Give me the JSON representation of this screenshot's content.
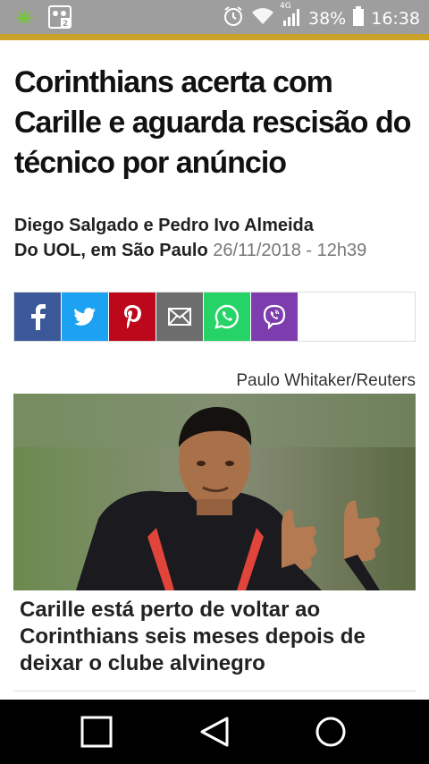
{
  "status_bar": {
    "battery_percent": "38%",
    "time": "16:38",
    "network_label": "4G",
    "icons": [
      "cannabis-leaf-icon",
      "notification-icon",
      "alarm-icon",
      "wifi-icon",
      "signal-icon",
      "battery-icon"
    ]
  },
  "article": {
    "headline": "Corinthians acerta com Carille e aguarda rescisão do técnico por anúncio",
    "authors": "Diego Salgado e Pedro Ivo Almeida",
    "org": "Do UOL, em São Paulo",
    "date": "26/11/2018 - 12h39",
    "photo_credit": "Paulo Whitaker/Reuters",
    "caption": "Carille está perto de voltar ao Corinthians seis meses depois de deixar o clube alvinegro"
  },
  "share": {
    "buttons": [
      {
        "name": "facebook",
        "color": "#3b5998"
      },
      {
        "name": "twitter",
        "color": "#1da1f2"
      },
      {
        "name": "pinterest",
        "color": "#bd081c"
      },
      {
        "name": "email",
        "color": "#6d6d6d"
      },
      {
        "name": "whatsapp",
        "color": "#25d366"
      },
      {
        "name": "viber",
        "color": "#7d3daf"
      }
    ]
  },
  "nav": {
    "buttons": [
      "recents-button",
      "back-button",
      "home-button"
    ]
  }
}
